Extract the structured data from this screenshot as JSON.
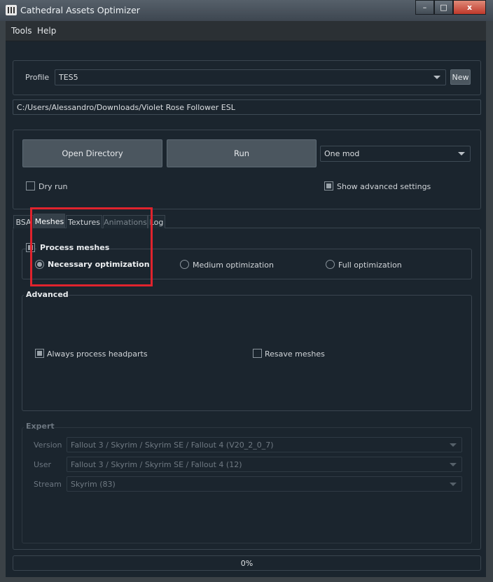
{
  "window": {
    "title": "Cathedral Assets Optimizer",
    "minimize": "–",
    "maximize": "□",
    "close": "x"
  },
  "menu": [
    "Tools",
    "Help"
  ],
  "profile": {
    "label": "Profile",
    "value": "TES5",
    "new_button": "New"
  },
  "path": "C:/Users/Alessandro/Downloads/Violet Rose Follower ESL",
  "actions": {
    "open_directory": "Open Directory",
    "run": "Run",
    "mode": "One mod",
    "dry_run": {
      "label": "Dry run",
      "checked": false
    },
    "show_advanced": {
      "label": "Show advanced settings",
      "checked": true
    }
  },
  "tabs": [
    {
      "label": "BSA",
      "active": false,
      "disabled": false
    },
    {
      "label": "Meshes",
      "active": true,
      "disabled": false
    },
    {
      "label": "Textures",
      "active": false,
      "disabled": false
    },
    {
      "label": "Animations",
      "active": false,
      "disabled": true
    },
    {
      "label": "Log",
      "active": false,
      "disabled": false
    }
  ],
  "meshes": {
    "process_meshes": "Process meshes",
    "options": [
      {
        "label": "Necessary optimization",
        "selected": true
      },
      {
        "label": "Medium optimization",
        "selected": false
      },
      {
        "label": "Full optimization",
        "selected": false
      }
    ],
    "advanced": {
      "title": "Advanced",
      "always_headparts": {
        "label": "Always process headparts",
        "checked": true
      },
      "resave_meshes": {
        "label": "Resave meshes",
        "checked": false
      }
    },
    "expert": {
      "title": "Expert",
      "version": {
        "label": "Version",
        "value": "Fallout 3 / Skyrim / Skyrim SE / Fallout 4 (V20_2_0_7)"
      },
      "user": {
        "label": "User",
        "value": "Fallout 3 / Skyrim / Skyrim SE / Fallout 4 (12)"
      },
      "stream": {
        "label": "Stream",
        "value": "Skyrim (83)"
      }
    }
  },
  "progress": {
    "value": 0,
    "text": "0%"
  },
  "colors": {
    "background": "#1b252e",
    "highlight": "#e0232d"
  }
}
